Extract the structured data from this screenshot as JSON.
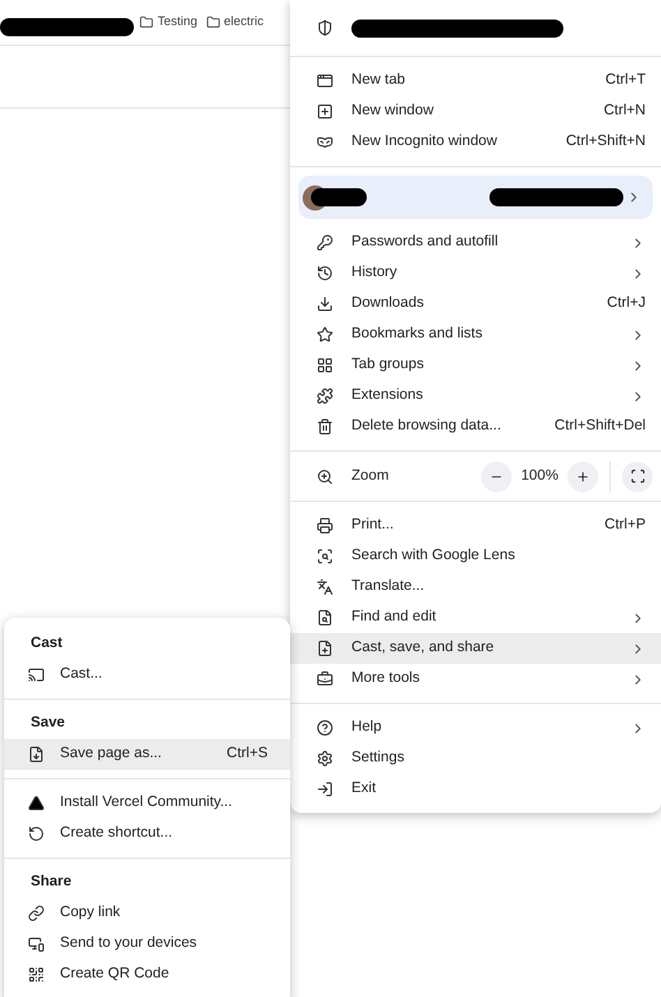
{
  "bookmarks": [
    {
      "label": "Testing"
    },
    {
      "label": "electric"
    }
  ],
  "menu": {
    "sections": [
      {
        "items": [
          {
            "label": "New tab",
            "shortcut": "Ctrl+T",
            "kind": "command",
            "highlighted": false
          },
          {
            "label": "New window",
            "shortcut": "Ctrl+N",
            "kind": "command",
            "highlighted": false
          },
          {
            "label": "New Incognito window",
            "shortcut": "Ctrl+Shift+N",
            "kind": "command",
            "highlighted": false
          }
        ]
      },
      {
        "items": [
          {
            "label": "Passwords and autofill",
            "kind": "submenu",
            "highlighted": false
          },
          {
            "label": "History",
            "kind": "submenu",
            "highlighted": false
          },
          {
            "label": "Downloads",
            "shortcut": "Ctrl+J",
            "kind": "command",
            "highlighted": false
          },
          {
            "label": "Bookmarks and lists",
            "kind": "submenu",
            "highlighted": false
          },
          {
            "label": "Tab groups",
            "kind": "submenu",
            "highlighted": false
          },
          {
            "label": "Extensions",
            "kind": "submenu",
            "highlighted": false
          },
          {
            "label": "Delete browsing data...",
            "shortcut": "Ctrl+Shift+Del",
            "kind": "command",
            "highlighted": false
          }
        ]
      },
      {
        "items": [
          {
            "label": "Print...",
            "shortcut": "Ctrl+P",
            "kind": "command",
            "highlighted": false
          },
          {
            "label": "Search with Google Lens",
            "kind": "command",
            "highlighted": false
          },
          {
            "label": "Translate...",
            "kind": "command",
            "highlighted": false
          },
          {
            "label": "Find and edit",
            "kind": "submenu",
            "highlighted": false
          },
          {
            "label": "Cast, save, and share",
            "kind": "submenu",
            "highlighted": true
          },
          {
            "label": "More tools",
            "kind": "submenu",
            "highlighted": false
          }
        ]
      },
      {
        "items": [
          {
            "label": "Help",
            "kind": "submenu",
            "highlighted": false
          },
          {
            "label": "Settings",
            "kind": "command",
            "highlighted": false
          },
          {
            "label": "Exit",
            "kind": "command",
            "highlighted": false
          }
        ]
      }
    ],
    "zoom": {
      "label": "Zoom",
      "value": "100%"
    }
  },
  "submenu": {
    "sections": [
      {
        "title": "Cast",
        "items": [
          {
            "label": "Cast...",
            "highlighted": false
          }
        ]
      },
      {
        "title": "Save",
        "items": [
          {
            "label": "Save page as...",
            "shortcut": "Ctrl+S",
            "highlighted": true
          }
        ]
      },
      {
        "items": [
          {
            "label": "Install Vercel Community...",
            "highlighted": false
          },
          {
            "label": "Create shortcut...",
            "highlighted": false
          }
        ]
      },
      {
        "title": "Share",
        "items": [
          {
            "label": "Copy link",
            "highlighted": false
          },
          {
            "label": "Send to your devices",
            "highlighted": false
          },
          {
            "label": "Create QR Code",
            "highlighted": false
          }
        ]
      }
    ]
  }
}
